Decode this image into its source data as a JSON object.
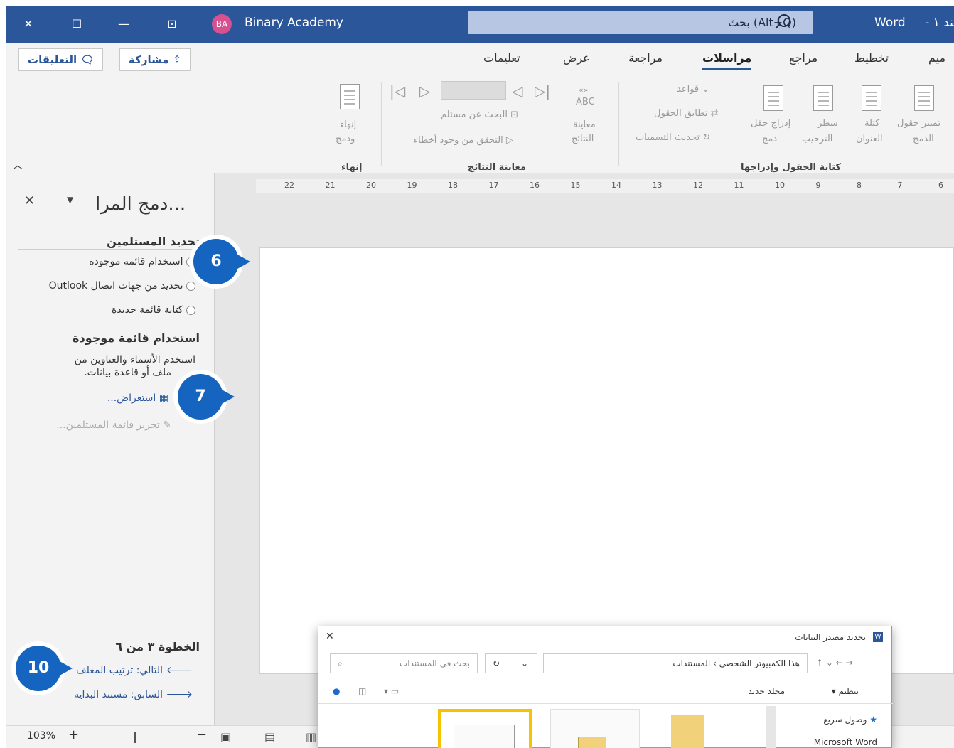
{
  "titlebar": {
    "app_title": "Binary Academy",
    "user_initials": "BA",
    "search_text": "بحث (Alt+Q)",
    "word_label": "Word",
    "doc_fragment": "تند ١ -"
  },
  "tabs": {
    "items": [
      "تعليمات",
      "عرض",
      "مراجعة",
      "مراسلات",
      "مراجع",
      "تخطيط",
      "ميم"
    ],
    "active": "مراسلات",
    "share_label": "مشاركة",
    "comments_label": "التعليقات"
  },
  "ribbon": {
    "finish_label": "إنهاء",
    "finish_merge": "إنهاء",
    "finish_merge2": "ودمج",
    "nav_box": "",
    "find_recipient": "البحث عن مستلم",
    "check_errors": "التحقق من وجود أخطاء",
    "preview_abc": "ABC",
    "preview_label1": "معاينة",
    "preview_label2": "النتائج",
    "preview_group": "معاينة النتائج",
    "rules": "قواعد",
    "match_fields": "تطابق الحقول",
    "update_labels": "تحديث التسميات",
    "insert_field1": "إدراج حقل",
    "insert_field2": "دمج",
    "greeting1": "سطر",
    "greeting2": "الترحيب",
    "address1": "كتلة",
    "address2": "العنوان",
    "highlight1": "تمييز حقول",
    "highlight2": "الدمج",
    "write_group": "كتابة الحقول وإدراجها"
  },
  "ruler": {
    "ticks": [
      "22",
      "21",
      "20",
      "19",
      "18",
      "17",
      "16",
      "15",
      "14",
      "13",
      "12",
      "11",
      "10",
      "9",
      "8",
      "7",
      "6"
    ]
  },
  "pane": {
    "title": "دمج المرا...",
    "section1": "تحديد المستلمين",
    "option1": "استخدام قائمة موجودة",
    "option2": "تحديد من جهات اتصال Outlook",
    "option3": "كتابة قائمة جديدة",
    "section2": "استخدام قائمة موجودة",
    "desc1": "استخدم الأسماء والعناوين من",
    "desc2": "ملف أو قاعدة بيانات.",
    "browse": "استعراض...",
    "edit_list": "تحرير قائمة المستلمين...",
    "step": "الخطوة ٣ من ٦",
    "next": "التالي: ترتيب المغلف",
    "prev": "السابق: مستند البداية"
  },
  "badges": {
    "b6": "6",
    "b7": "7",
    "b10": "10"
  },
  "statusbar": {
    "zoom": "103%"
  },
  "dialog": {
    "title": "تحديد مصدر البيانات",
    "path_this_pc": "هذا الكمبيوتر الشخصي",
    "path_docs": "المستندات",
    "search_placeholder": "بحث في المستندات",
    "organize": "تنظيم",
    "new_folder": "مجلد جديد",
    "quick_access": "وصول سريع",
    "ms_word": "Microsoft Word"
  },
  "colors": {
    "titlebar": "#2b579a",
    "badge": "#1565c0",
    "highlight": "#f5c400"
  }
}
